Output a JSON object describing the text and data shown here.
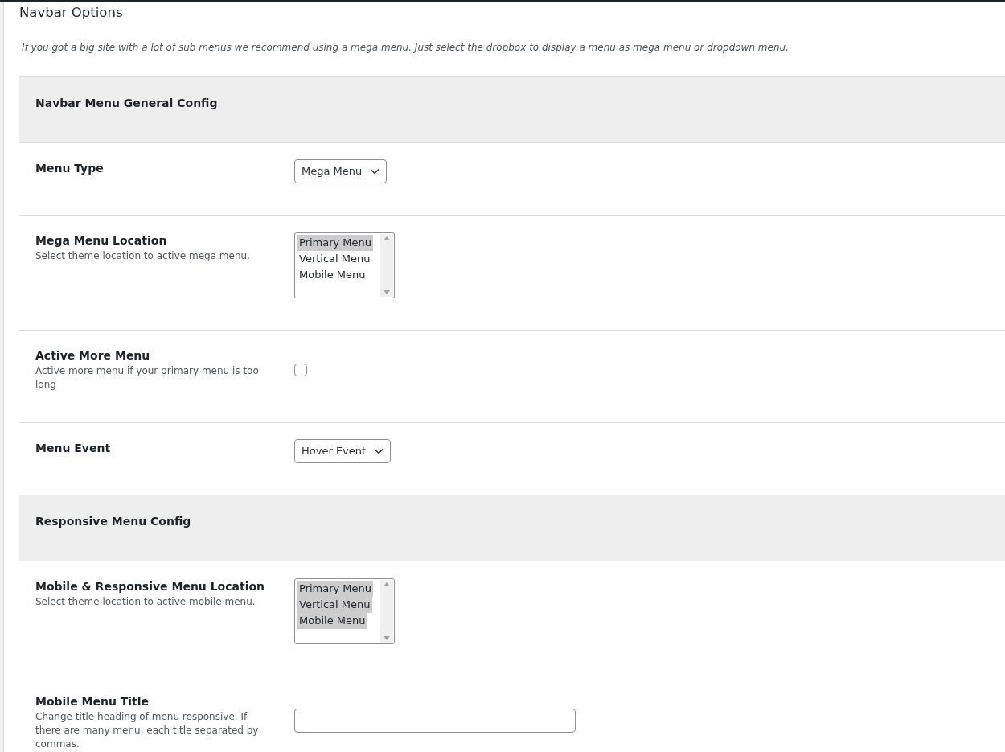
{
  "title": "Navbar Options",
  "description": "If you got a big site with a lot of sub menus we recommend using a mega menu. Just select the dropbox to display a menu as mega menu or dropdown menu.",
  "rows": [
    {
      "kind": "section",
      "label": "Navbar Menu General Config"
    },
    {
      "kind": "select",
      "label": "Menu Type",
      "value": "Mega Menu"
    },
    {
      "kind": "listbox",
      "label": "Mega Menu Location",
      "help": "Select theme location to active mega menu.",
      "options": [
        {
          "label": "Primary Menu",
          "selected": true
        },
        {
          "label": "Vertical Menu",
          "selected": false
        },
        {
          "label": "Mobile Menu",
          "selected": false
        }
      ]
    },
    {
      "kind": "checkbox",
      "label": "Active More Menu",
      "help": "Active more menu if your primary menu is too long",
      "checked": false
    },
    {
      "kind": "select",
      "label": "Menu Event",
      "value": "Hover Event"
    },
    {
      "kind": "section",
      "label": "Responsive Menu Config"
    },
    {
      "kind": "listbox",
      "label": "Mobile & Responsive Menu Location",
      "help": "Select theme location to active mobile menu.",
      "options": [
        {
          "label": "Primary Menu",
          "selected": true
        },
        {
          "label": "Vertical Menu",
          "selected": true
        },
        {
          "label": "Mobile Menu",
          "selected": true
        }
      ]
    },
    {
      "kind": "text",
      "label": "Mobile Menu Title",
      "help": "Change title heading of menu responsive. If there are many menu, each title separated by commas."
    }
  ]
}
